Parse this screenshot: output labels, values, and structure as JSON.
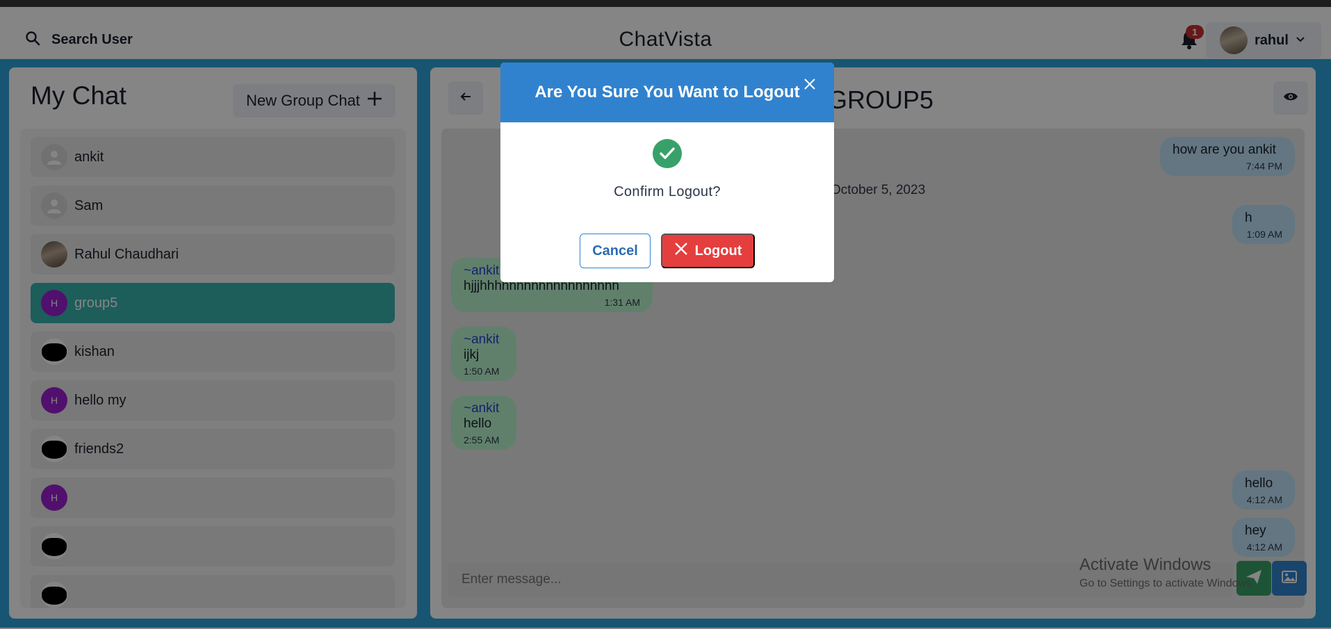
{
  "header": {
    "search_label": "Search User",
    "app_title": "ChatVista",
    "notification_count": "1",
    "user_name": "rahul"
  },
  "sidebar": {
    "title": "My Chat",
    "new_group_label": "New Group Chat",
    "chats": [
      {
        "name": "ankit",
        "avatar": "default",
        "initial": ""
      },
      {
        "name": "Sam",
        "avatar": "default",
        "initial": ""
      },
      {
        "name": "Rahul Chaudhari",
        "avatar": "photo",
        "initial": ""
      },
      {
        "name": "group5",
        "avatar": "letter",
        "initial": "H",
        "active": true
      },
      {
        "name": "kishan",
        "avatar": "black",
        "initial": ""
      },
      {
        "name": "hello my",
        "avatar": "letter",
        "initial": "H"
      },
      {
        "name": "friends2",
        "avatar": "black",
        "initial": ""
      },
      {
        "name": "",
        "avatar": "letter",
        "initial": "H"
      },
      {
        "name": "",
        "avatar": "black",
        "initial": ""
      },
      {
        "name": "",
        "avatar": "black",
        "initial": ""
      }
    ]
  },
  "chat": {
    "title": "GROUP5",
    "date_separator": "October 5, 2023",
    "messages": [
      {
        "direction": "out",
        "text": "how are you ankit",
        "time": "7:44 PM"
      },
      {
        "direction": "out",
        "text": "h",
        "time": "1:09 AM"
      },
      {
        "direction": "in",
        "sender": "~ankit",
        "text": "hjjjhhhhhhhhhhhhhhhhhhh",
        "time": "1:31 AM"
      },
      {
        "direction": "in",
        "sender": "~ankit",
        "text": "ijkj",
        "time": "1:50 AM"
      },
      {
        "direction": "in",
        "sender": "~ankit",
        "text": "hello",
        "time": "2:55 AM"
      },
      {
        "direction": "out",
        "text": "hello",
        "time": "4:12 AM"
      },
      {
        "direction": "out",
        "text": "hey",
        "time": "4:12 AM"
      }
    ],
    "input_placeholder": "Enter message..."
  },
  "watermark": {
    "line1": "Activate Windows",
    "line2": "Go to Settings to activate Windows."
  },
  "modal": {
    "title": "Are You Sure You Want to Logout",
    "message": "Confirm Logout?",
    "cancel_label": "Cancel",
    "logout_label": "Logout"
  },
  "colors": {
    "accent_blue": "#3182ce",
    "main_background": "#2ea3db",
    "active_chat": "#38b2ac",
    "logout_red": "#e53e3e",
    "incoming_bubble": "#b9f5d0",
    "outgoing_bubble": "#bee3f8",
    "group_avatar": "#9b1fd1"
  }
}
